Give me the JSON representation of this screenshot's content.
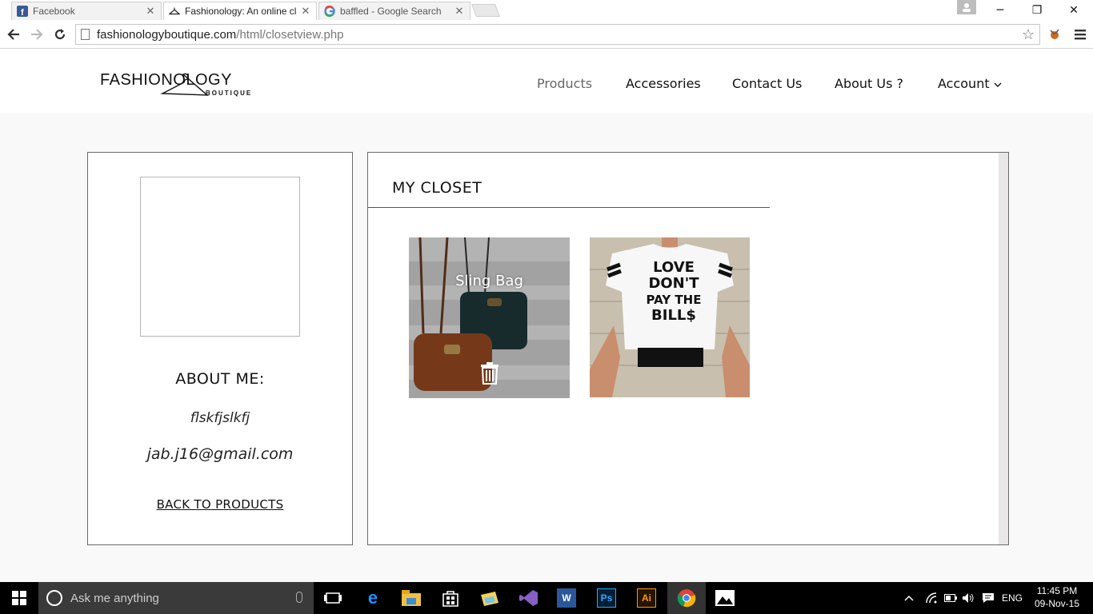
{
  "browser": {
    "tabs": [
      {
        "title": "Facebook",
        "icon": "facebook-icon",
        "active": false
      },
      {
        "title": "Fashionology: An online cl",
        "icon": "hanger-icon",
        "active": true
      },
      {
        "title": "baffled - Google Search",
        "icon": "google-icon",
        "active": false
      }
    ],
    "url_domain": "fashionologyboutique.com",
    "url_path": "/html/closetview.php"
  },
  "site": {
    "logo_text": "FASHIONOLOGY",
    "logo_sub": "BOUTIQUE",
    "nav": [
      {
        "label": "Products"
      },
      {
        "label": "Accessories"
      },
      {
        "label": "Contact Us"
      },
      {
        "label": "About Us ?"
      },
      {
        "label": "Account"
      }
    ]
  },
  "profile": {
    "about_title": "ABOUT ME:",
    "about_text": "flskfjslkfj",
    "email": "jab.j16@gmail.com",
    "back_link": "BACK TO PRODUCTS"
  },
  "closet": {
    "title": "MY CLOSET",
    "items": [
      {
        "label": "Sling Bag",
        "image": "sling-bags-photo"
      },
      {
        "label": "",
        "image": "love-dont-pay-the-bills-shirt-photo",
        "shirt_text": [
          "LOVE",
          "DON'T",
          "PAY THE",
          "BILL$"
        ]
      }
    ]
  },
  "taskbar": {
    "search_placeholder": "Ask me anything",
    "language": "ENG",
    "time": "11:45 PM",
    "date": "09-Nov-15"
  },
  "colors": {
    "page_bg": "#f9f9f9",
    "border": "#6a6a6a",
    "taskbar": "#000000",
    "search_bg": "#3a3a3a"
  }
}
